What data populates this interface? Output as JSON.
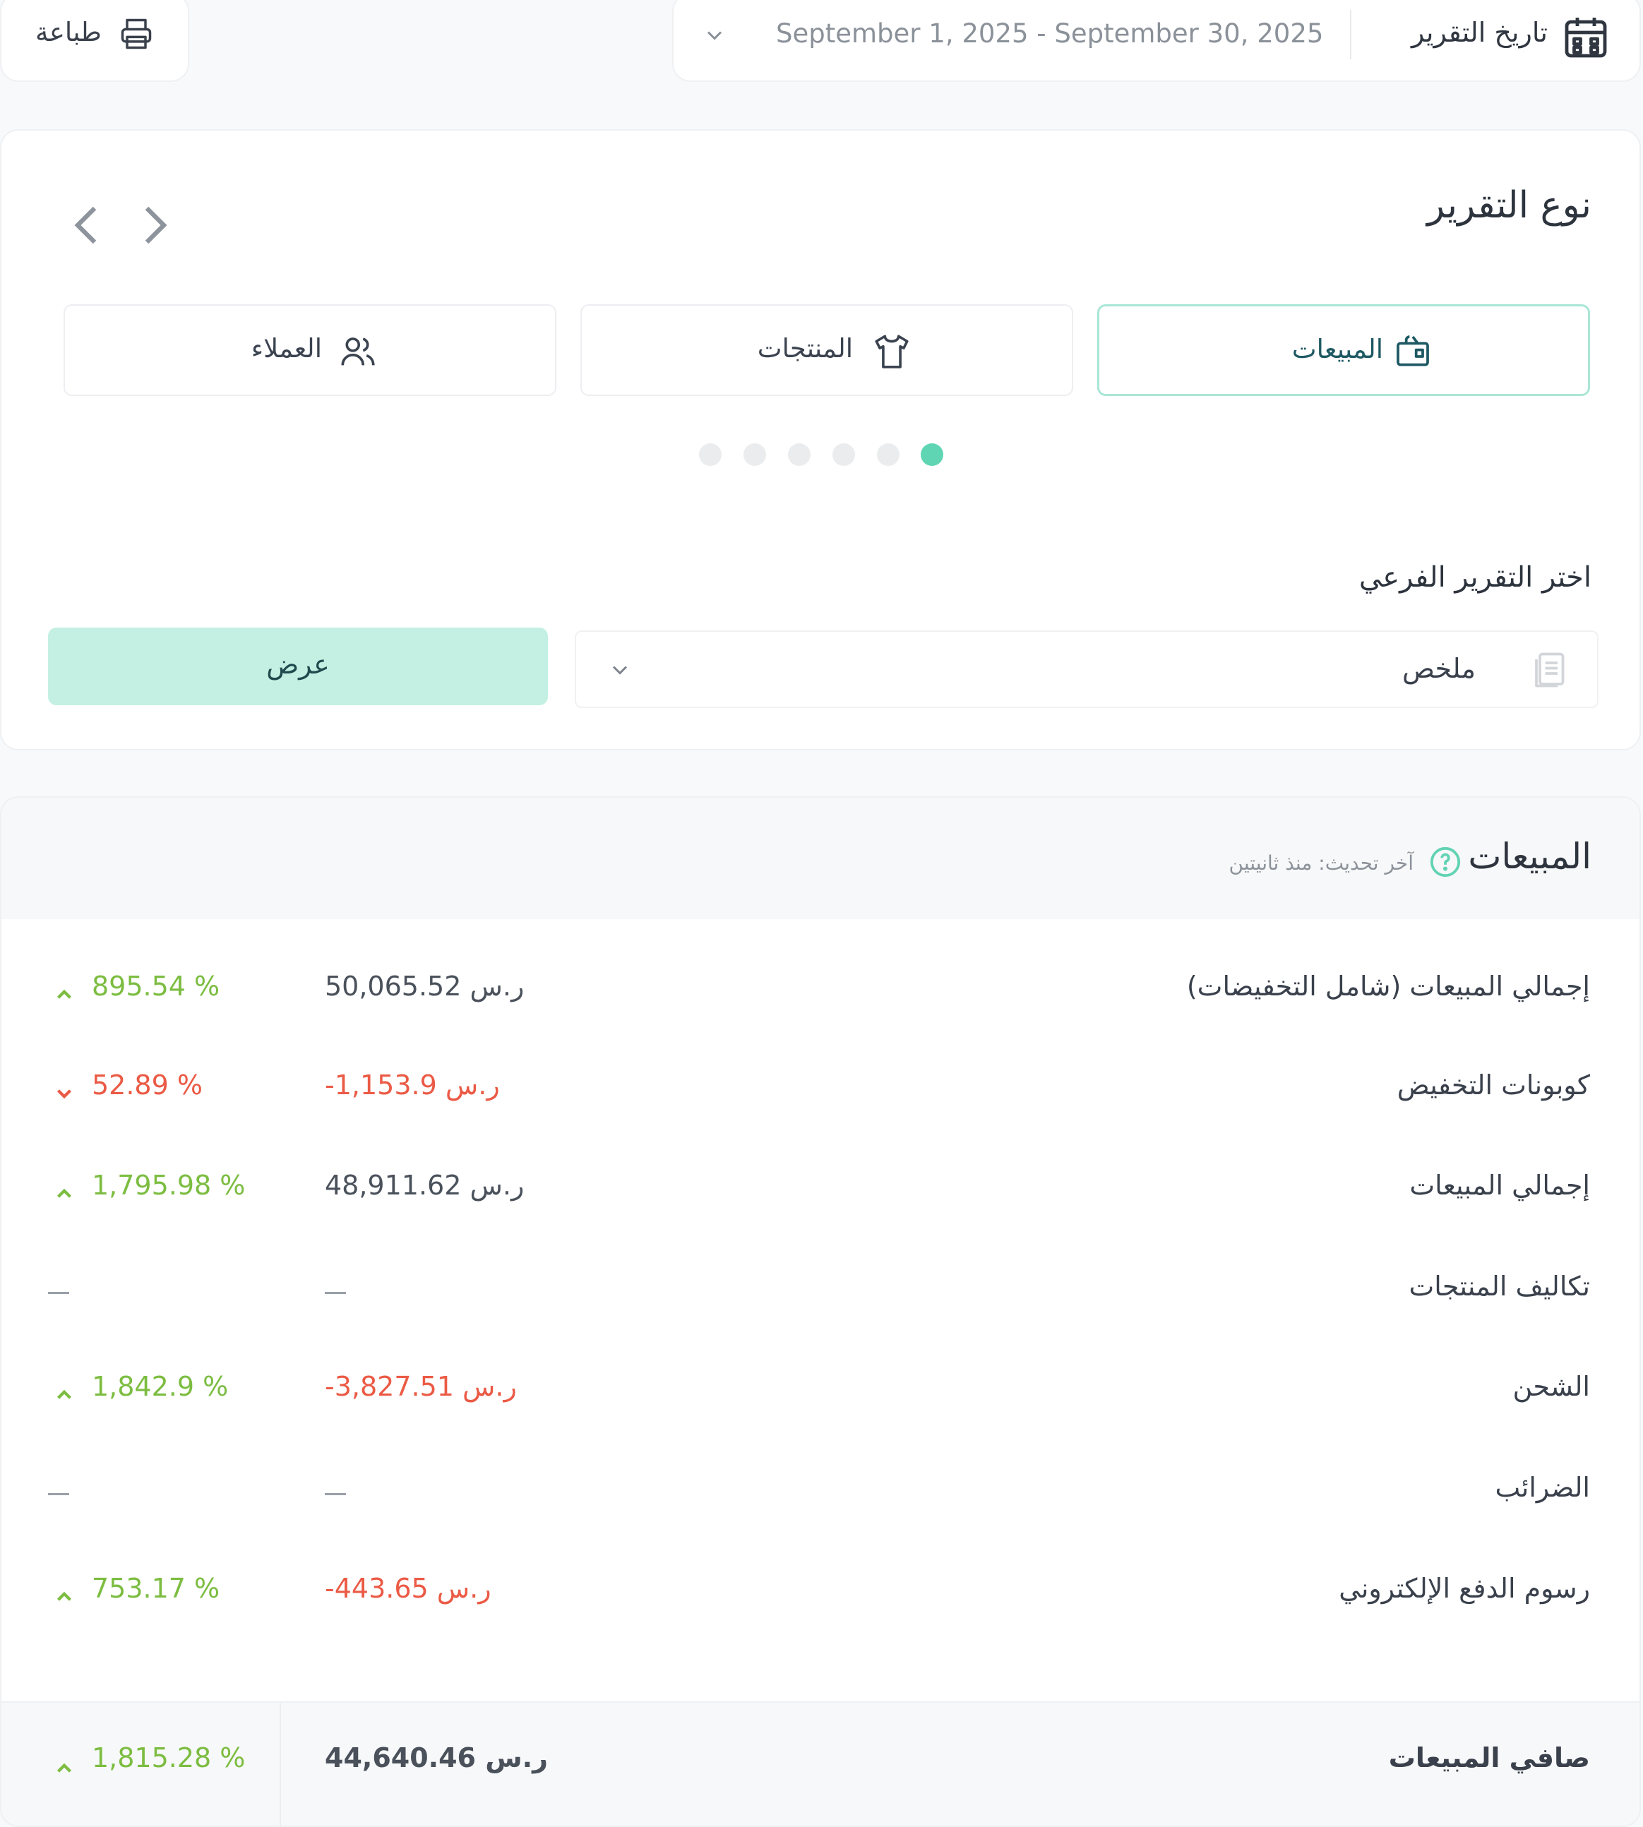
{
  "top_bar": {
    "print_label": "طباعة",
    "date_label": "تاريخ التقرير",
    "date_range": "September 1, 2025 - September 30, 2025"
  },
  "report_type": {
    "title": "نوع التقرير",
    "tabs": [
      {
        "label": "المبيعات",
        "icon": "sales-bag-icon",
        "active": true
      },
      {
        "label": "المنتجات",
        "icon": "shirt-icon",
        "active": false
      },
      {
        "label": "العملاء",
        "icon": "users-icon",
        "active": false
      }
    ],
    "pagination": {
      "total_dots": 6,
      "active_dot": 1
    },
    "subreport_label": "اختر التقرير الفرعي",
    "subreport_value": "ملخص",
    "view_button": "عرض"
  },
  "sales": {
    "title": "المبيعات",
    "last_update": "آخر تحديث: منذ ثانيتين",
    "rows": [
      {
        "label": "إجمالي المبيعات (شامل التخفيضات)",
        "amount": "50,065.52",
        "currency": "ر.س",
        "amount_negative": false,
        "change": "895.54 %",
        "trend": "up"
      },
      {
        "label": "كوبونات التخفيض",
        "amount": "-1,153.9",
        "currency": "ر.س",
        "amount_negative": true,
        "change": "52.89 %",
        "trend": "down"
      },
      {
        "label": "إجمالي المبيعات",
        "amount": "48,911.62",
        "currency": "ر.س",
        "amount_negative": false,
        "change": "1,795.98 %",
        "trend": "up"
      },
      {
        "label": "تكاليف المنتجات",
        "amount": null,
        "change": null
      },
      {
        "label": "الشحن",
        "amount": "-3,827.51",
        "currency": "ر.س",
        "amount_negative": true,
        "change": "1,842.9 %",
        "trend": "up"
      },
      {
        "label": "الضرائب",
        "amount": null,
        "change": null
      },
      {
        "label": "رسوم الدفع الإلكتروني",
        "amount": "-443.65",
        "currency": "ر.س",
        "amount_negative": true,
        "change": "753.17 %",
        "trend": "up"
      }
    ],
    "net": {
      "label": "صافي المبيعات",
      "amount": "44,640.46",
      "currency": "ر.س",
      "change": "1,815.28 %",
      "trend": "up"
    }
  },
  "colors": {
    "accent": "#5fd5b4",
    "button_bg": "#c3f0e2",
    "positive": "#7cbd41",
    "negative": "#eb5a45"
  }
}
